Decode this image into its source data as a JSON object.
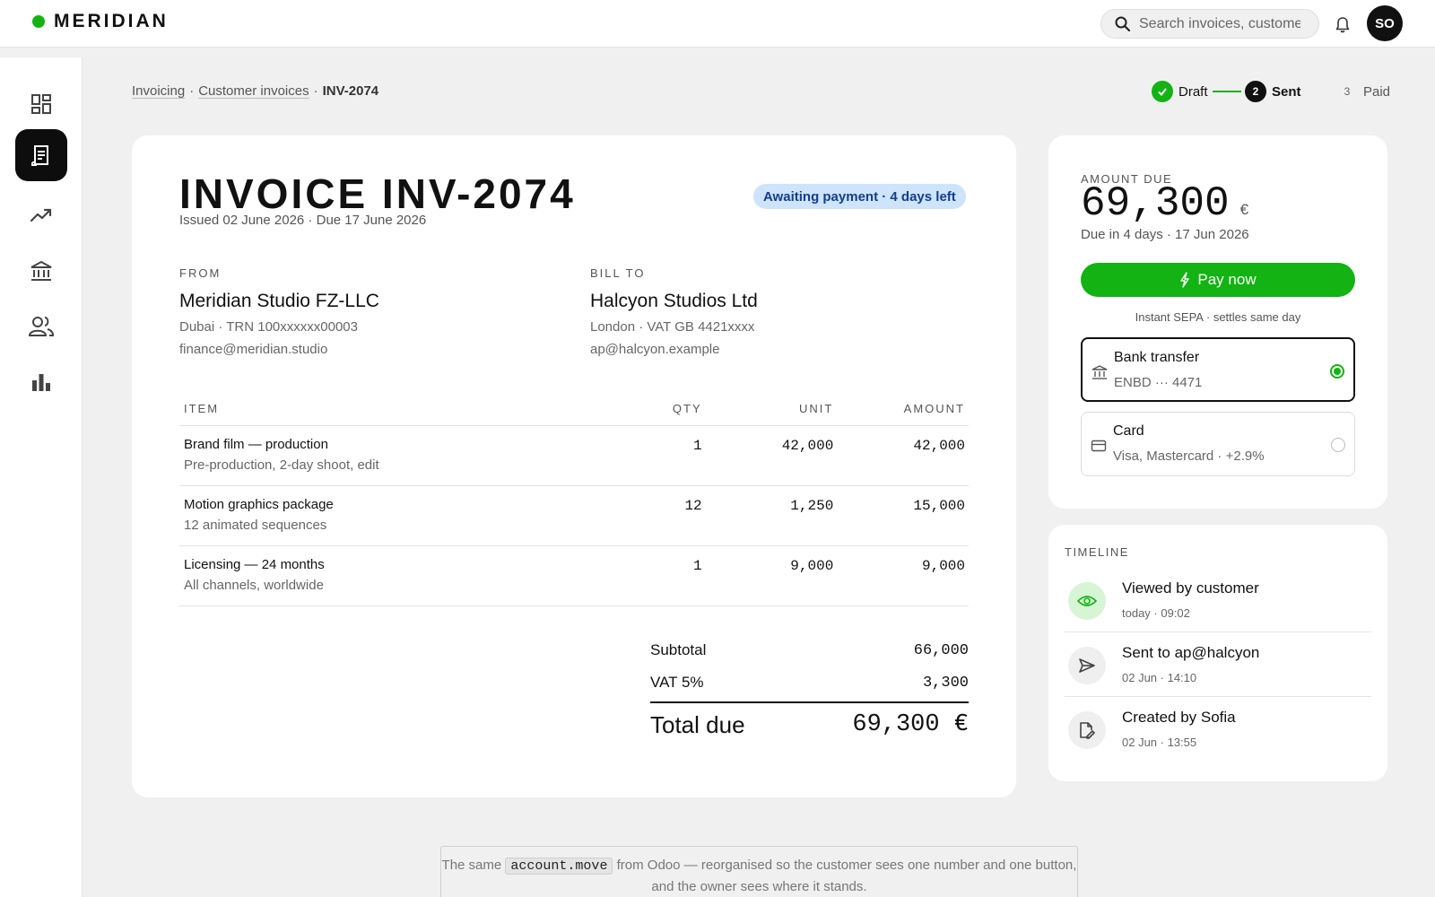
{
  "app": {
    "brand": "MERIDIAN",
    "accent": "#12b312"
  },
  "header": {
    "search_placeholder": "Search invoices, customers",
    "user_initials": "SO"
  },
  "sidebar": {
    "items": [
      {
        "icon": "dashboard-icon",
        "active": false
      },
      {
        "icon": "invoice-icon",
        "active": true
      },
      {
        "icon": "trending-up-icon",
        "active": false
      },
      {
        "icon": "bank-icon",
        "active": false
      },
      {
        "icon": "people-icon",
        "active": false
      },
      {
        "icon": "bar-chart-icon",
        "active": false
      }
    ]
  },
  "breadcrumb": {
    "items": [
      "Invoicing",
      "Customer invoices",
      "INV-2074"
    ],
    "separator": "·"
  },
  "stepper": {
    "steps": [
      {
        "number": "1",
        "label": "Draft",
        "state": "done"
      },
      {
        "number": "2",
        "label": "Sent",
        "state": "current"
      },
      {
        "number": "3",
        "label": "Paid",
        "state": "todo"
      }
    ]
  },
  "invoice": {
    "title": "INVOICE INV-2074",
    "issued": "Issued 02 June 2026 · Due 17 June 2026",
    "status": "Awaiting payment · 4 days left",
    "from": {
      "label": "FROM",
      "name": "Meridian Studio FZ-LLC",
      "line1": "Dubai · TRN 100xxxxxx00003",
      "line2": "finance@meridian.studio"
    },
    "bill_to": {
      "label": "BILL TO",
      "name": "Halcyon Studios Ltd",
      "line1": "London · VAT GB 4421xxxx",
      "line2": "ap@halcyon.example"
    },
    "columns": {
      "item": "ITEM",
      "qty": "QTY",
      "unit": "UNIT",
      "amount": "AMOUNT"
    },
    "items": [
      {
        "name": "Brand film — production",
        "desc": "Pre-production, 2-day shoot, edit",
        "qty": "1",
        "unit": "42,000",
        "amount": "42,000"
      },
      {
        "name": "Motion graphics package",
        "desc": "12 animated sequences",
        "qty": "12",
        "unit": "1,250",
        "amount": "15,000"
      },
      {
        "name": "Licensing — 24 months",
        "desc": "All channels, worldwide",
        "qty": "1",
        "unit": "9,000",
        "amount": "9,000"
      }
    ],
    "totals": {
      "subtotal_label": "Subtotal",
      "subtotal": "66,000",
      "vat_label": "VAT 5%",
      "vat": "3,300",
      "total_label": "Total due",
      "total": "69,300 €"
    }
  },
  "payment": {
    "due_label": "AMOUNT DUE",
    "due_amount": "69,300",
    "currency": "€",
    "due_when": "Due in 4 days · 17 Jun 2026",
    "pay_button": "Pay now",
    "note": "Instant SEPA · settles same day",
    "methods": [
      {
        "title": "Bank transfer",
        "sub": "ENBD ··· 4471",
        "selected": true,
        "icon": "bank-icon"
      },
      {
        "title": "Card",
        "sub": "Visa, Mastercard · +2.9%",
        "selected": false,
        "icon": "credit-card-icon"
      }
    ]
  },
  "timeline": {
    "label": "TIMELINE",
    "events": [
      {
        "title": "Viewed by customer",
        "meta": "today · 09:02",
        "icon": "eye-icon"
      },
      {
        "title": "Sent to ap@halcyon",
        "meta": "02 Jun · 14:10",
        "icon": "send-icon"
      },
      {
        "title": "Created by Sofia",
        "meta": "02 Jun · 13:55",
        "icon": "document-edit-icon"
      }
    ]
  },
  "footnote": {
    "before": "The same",
    "code": "account.move",
    "after": "from Odoo — reorganised so the customer sees one number and one button, and the owner sees where it stands."
  }
}
